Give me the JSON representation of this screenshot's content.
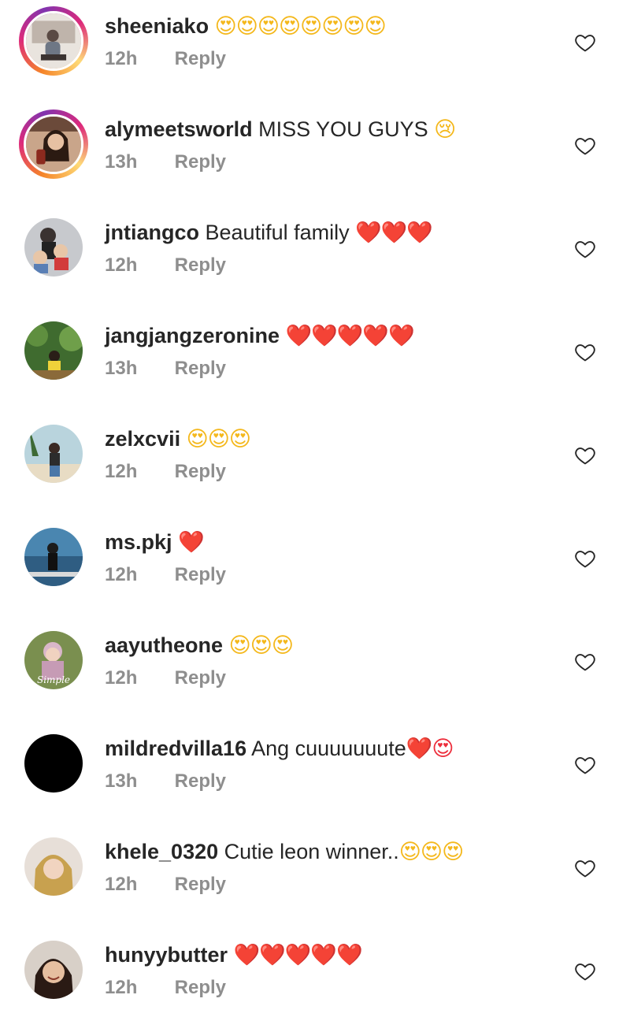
{
  "comments": [
    {
      "username": "sheeniako",
      "text": "",
      "emojis": "😍😍😍😍😍😍😍😍",
      "time": "12h",
      "reply": "Reply",
      "avatar": {
        "story": true,
        "bg": "#e9e4de",
        "fg": "#5a4a44"
      }
    },
    {
      "username": "alymeetsworld",
      "text": "MISS YOU GUYS",
      "emojis": "😢",
      "time": "13h",
      "reply": "Reply",
      "avatar": {
        "story": true,
        "bg": "#c9a58a",
        "fg": "#2b1a12"
      }
    },
    {
      "username": "jntiangco",
      "text": "Beautiful family",
      "emojis": "❤️❤️❤️",
      "time": "12h",
      "reply": "Reply",
      "avatar": {
        "story": false,
        "bg": "#c7c9cd",
        "fg": "#3a3230"
      }
    },
    {
      "username": "jangjangzeronine",
      "text": "",
      "emojis": "❤️❤️❤️❤️❤️",
      "time": "13h",
      "reply": "Reply",
      "avatar": {
        "story": false,
        "bg": "#3f6b2f",
        "fg": "#2a1f18"
      }
    },
    {
      "username": "zelxcvii",
      "text": "",
      "emojis": "😍😍😍",
      "time": "12h",
      "reply": "Reply",
      "avatar": {
        "story": false,
        "bg": "#b9d4dd",
        "fg": "#3a2a24"
      }
    },
    {
      "username": "ms.pkj",
      "text": "",
      "emojis": "❤️",
      "time": "12h",
      "reply": "Reply",
      "avatar": {
        "story": false,
        "bg": "#4a86b0",
        "fg": "#1c1c1c"
      }
    },
    {
      "username": "aayutheone",
      "text": "",
      "emojis": "😍😍😍",
      "time": "12h",
      "reply": "Reply",
      "avatar": {
        "story": false,
        "bg": "#7a8f4f",
        "fg": "#d9b7c9",
        "overlay_text": "Simple"
      }
    },
    {
      "username": "mildredvilla16",
      "text": "Ang cuuuuuuute",
      "emojis": "❤️😍",
      "time": "13h",
      "reply": "Reply",
      "avatar": {
        "story": false,
        "bg": "#000000",
        "fg": "#000000"
      }
    },
    {
      "username": "khele_0320",
      "text": "Cutie leon winner..",
      "emojis": "😍😍😍",
      "time": "12h",
      "reply": "Reply",
      "avatar": {
        "story": false,
        "bg": "#e7dfd8",
        "fg": "#c8a14f"
      }
    },
    {
      "username": "hunyybutter",
      "text": "",
      "emojis": "❤️❤️❤️❤️❤️",
      "time": "12h",
      "reply": "Reply",
      "avatar": {
        "story": false,
        "bg": "#d8d0c8",
        "fg": "#2a1a14"
      }
    }
  ],
  "icons": {
    "like": "heart-outline-icon"
  },
  "colors": {
    "text": "#262626",
    "meta": "#8e8e8e",
    "heart": "#ed2d3b"
  }
}
